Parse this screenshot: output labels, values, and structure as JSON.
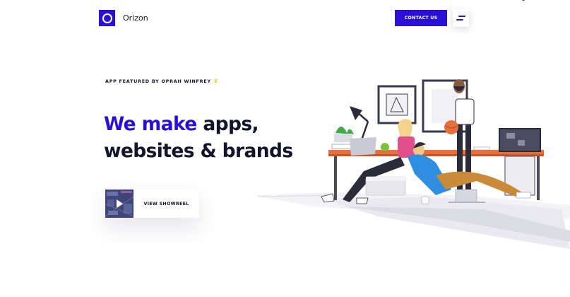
{
  "header": {
    "brand_name": "Orizon",
    "contact_label": "CONTACT US",
    "logo_icon": "ring-logo-icon",
    "menu_icon": "hamburger-menu-icon"
  },
  "hero": {
    "featured": "APP FEATURED BY OPRAH WINFREY",
    "featured_icon": "crown-icon",
    "headline_line1_accent": "We make",
    "headline_line1_rest": "apps,",
    "headline_line2": "websites & brands",
    "showreel_label": "VIEW SHOWREEL",
    "showreel_icon": "play-icon"
  },
  "illustration": {
    "description_icon": "office-team-illustration"
  },
  "colors": {
    "accent": "#2a0fd6",
    "text": "#14142b",
    "background": "#ffffff"
  }
}
